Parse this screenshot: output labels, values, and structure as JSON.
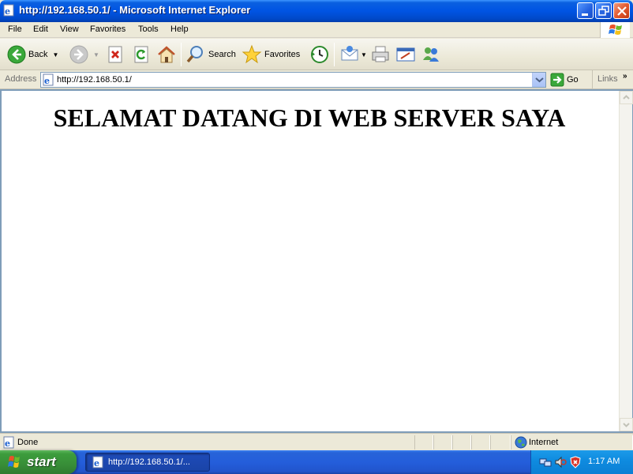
{
  "window": {
    "title": "http://192.168.50.1/ - Microsoft Internet Explorer"
  },
  "menu": {
    "items": [
      "File",
      "Edit",
      "View",
      "Favorites",
      "Tools",
      "Help"
    ]
  },
  "toolbar": {
    "back_label": "Back",
    "search_label": "Search",
    "favorites_label": "Favorites"
  },
  "address": {
    "label": "Address",
    "value": "http://192.168.50.1/",
    "go_label": "Go",
    "links_label": "Links"
  },
  "page": {
    "heading": "SELAMAT DATANG DI WEB SERVER SAYA"
  },
  "status": {
    "text": "Done",
    "zone": "Internet"
  },
  "taskbar": {
    "start_label": "start",
    "task_label": "http://192.168.50.1/...",
    "clock": "1:17 AM"
  },
  "colors": {
    "titlebar": "#0054e3",
    "start_button": "#388e38",
    "taskbar": "#245edb",
    "tray": "#0f8ce0"
  }
}
